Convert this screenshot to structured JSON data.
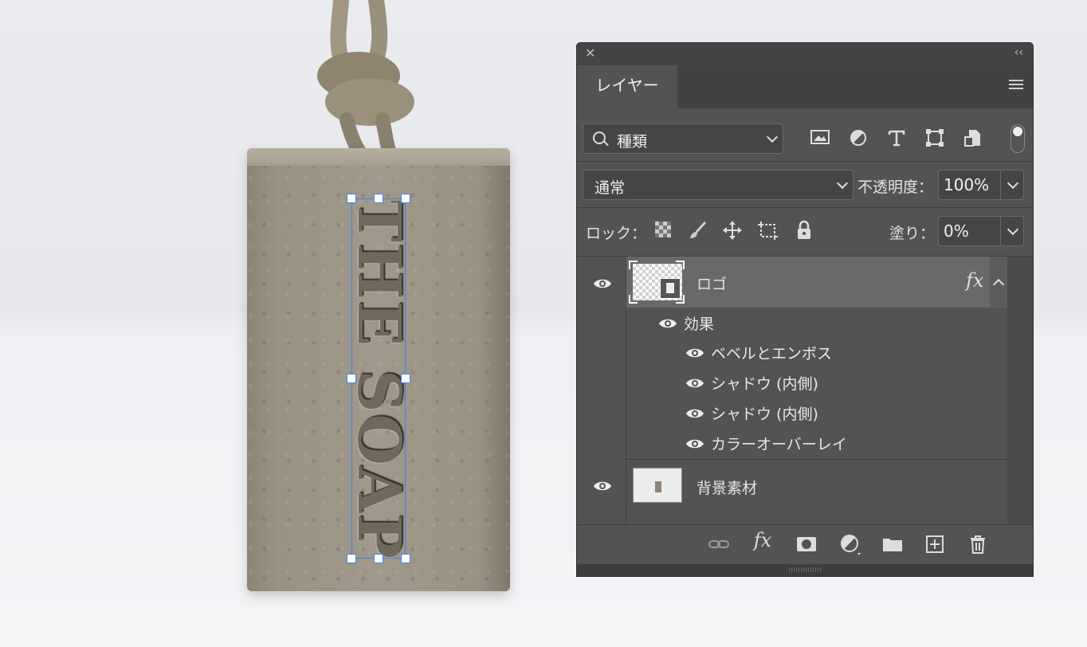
{
  "canvas": {
    "artwork_text": "THE SOAP"
  },
  "panel": {
    "close_label": "✕",
    "collapse_label": "‹‹",
    "tab_label": "レイヤー",
    "filter": {
      "value": "種類"
    },
    "filter_icons": [
      "image-filter-icon",
      "adjustment-filter-icon",
      "type-filter-icon",
      "shape-filter-icon",
      "smart-object-filter-icon"
    ],
    "blend_mode": "通常",
    "opacity_label": "不透明度：",
    "opacity_value": "100%",
    "lock_label": "ロック：",
    "lock_icons": [
      "lock-transparent-pixels-icon",
      "lock-image-pixels-icon",
      "lock-position-icon",
      "lock-artboard-icon",
      "lock-all-icon"
    ],
    "fill_label": "塗り：",
    "fill_value": "0%",
    "layers": [
      {
        "name": "ロゴ",
        "selected": true,
        "fx_label": "fx",
        "effects_label": "効果",
        "effects": [
          "ベベルとエンボス",
          "シャドウ (内側)",
          "シャドウ (内側)",
          "カラーオーバーレイ"
        ]
      },
      {
        "name": "背景素材",
        "selected": false
      }
    ],
    "bottom_icons": [
      "link-layers-icon",
      "add-layer-style-icon",
      "add-mask-icon",
      "new-adjustment-layer-icon",
      "new-group-icon",
      "new-layer-icon",
      "delete-layer-icon"
    ],
    "fx_button_label": "fx"
  },
  "colors": {
    "panel_bg": "#535353",
    "selected_row": "#696969",
    "selection_blue": "#3f7ff0"
  }
}
